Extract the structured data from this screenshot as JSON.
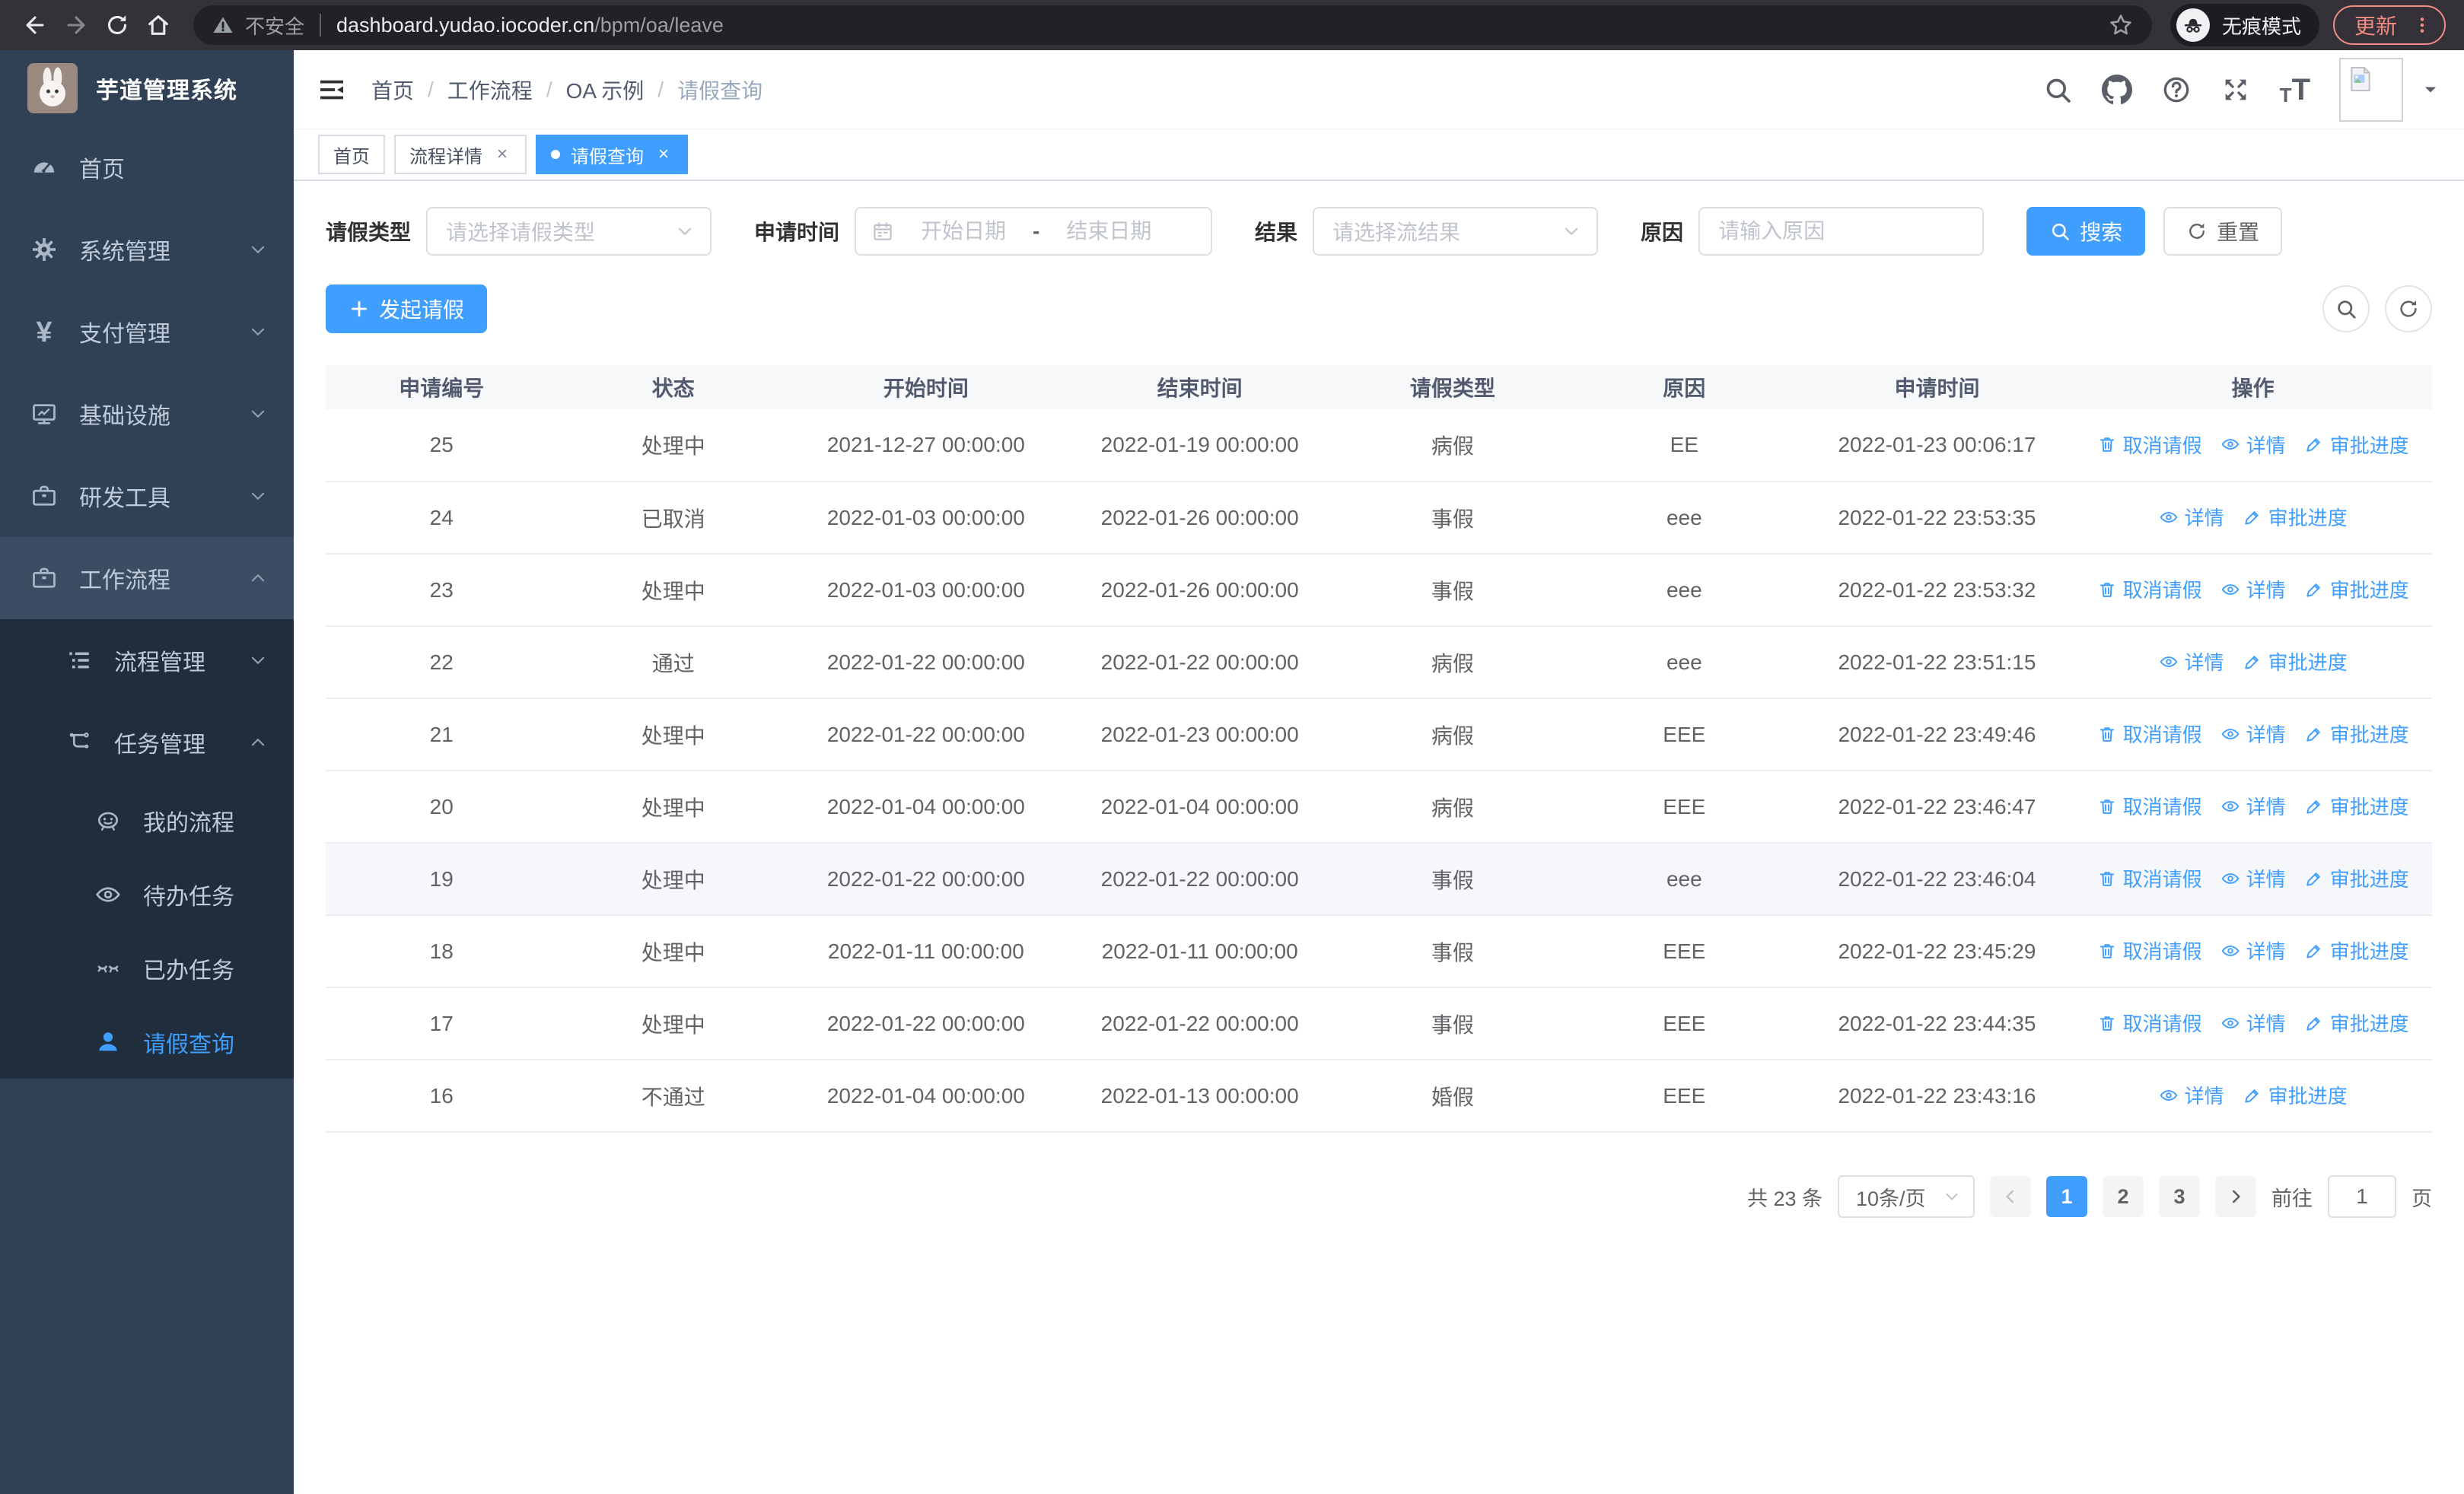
{
  "browser": {
    "security_label": "不安全",
    "url_host": "dashboard.yudao.iocoder.cn",
    "url_path": "/bpm/oa/leave",
    "incognito_label": "无痕模式",
    "update_label": "更新"
  },
  "colors": {
    "primary": "#409eff",
    "sidebar_bg": "#304156",
    "submenu_bg": "#1f2d3d",
    "update_accent": "#f28b82",
    "link_blue": "#409eff"
  },
  "icons": {
    "sidebar": [
      "dashboard-icon",
      "gear-icon",
      "yen-icon",
      "monitor-icon",
      "toolbox-icon",
      "toolbox-icon",
      "list-icon",
      "flow-icon",
      "robot-icon",
      "eye-icon",
      "eye-closed-icon",
      "person-icon"
    ],
    "navbar": [
      "search-icon",
      "github-icon",
      "question-icon",
      "fullscreen-icon",
      "font-size-icon",
      "avatar-placeholder",
      "caret-down-icon"
    ]
  },
  "sidebar": {
    "title": "芋道管理系统",
    "items": [
      {
        "label": "首页"
      },
      {
        "label": "系统管理"
      },
      {
        "label": "支付管理"
      },
      {
        "label": "基础设施"
      },
      {
        "label": "研发工具"
      },
      {
        "label": "工作流程"
      },
      {
        "label": "流程管理"
      },
      {
        "label": "任务管理"
      },
      {
        "label": "我的流程"
      },
      {
        "label": "待办任务"
      },
      {
        "label": "已办任务"
      },
      {
        "label": "请假查询"
      }
    ]
  },
  "breadcrumb": {
    "items": [
      "首页",
      "工作流程",
      "OA 示例",
      "请假查询"
    ]
  },
  "tabs": [
    {
      "label": "首页"
    },
    {
      "label": "流程详情"
    },
    {
      "label": "请假查询"
    }
  ],
  "filters": {
    "leave_type_label": "请假类型",
    "leave_type_placeholder": "请选择请假类型",
    "apply_time_label": "申请时间",
    "start_date_placeholder": "开始日期",
    "range_separator": "-",
    "end_date_placeholder": "结束日期",
    "result_label": "结果",
    "result_placeholder": "请选择流结果",
    "reason_label": "原因",
    "reason_placeholder": "请输入原因",
    "search_label": "搜索",
    "reset_label": "重置"
  },
  "toolbar": {
    "create_label": "发起请假"
  },
  "table": {
    "columns": [
      "申请编号",
      "状态",
      "开始时间",
      "结束时间",
      "请假类型",
      "原因",
      "申请时间",
      "操作"
    ],
    "actions": {
      "cancel": "取消请假",
      "detail": "详情",
      "progress": "审批进度"
    },
    "rows": [
      {
        "id": "25",
        "status": "处理中",
        "start": "2021-12-27 00:00:00",
        "end": "2022-01-19 00:00:00",
        "type": "病假",
        "reason": "EE",
        "apply_time": "2022-01-23 00:06:17"
      },
      {
        "id": "24",
        "status": "已取消",
        "start": "2022-01-03 00:00:00",
        "end": "2022-01-26 00:00:00",
        "type": "事假",
        "reason": "eee",
        "apply_time": "2022-01-22 23:53:35"
      },
      {
        "id": "23",
        "status": "处理中",
        "start": "2022-01-03 00:00:00",
        "end": "2022-01-26 00:00:00",
        "type": "事假",
        "reason": "eee",
        "apply_time": "2022-01-22 23:53:32"
      },
      {
        "id": "22",
        "status": "通过",
        "start": "2022-01-22 00:00:00",
        "end": "2022-01-22 00:00:00",
        "type": "病假",
        "reason": "eee",
        "apply_time": "2022-01-22 23:51:15"
      },
      {
        "id": "21",
        "status": "处理中",
        "start": "2022-01-22 00:00:00",
        "end": "2022-01-23 00:00:00",
        "type": "病假",
        "reason": "EEE",
        "apply_time": "2022-01-22 23:49:46"
      },
      {
        "id": "20",
        "status": "处理中",
        "start": "2022-01-04 00:00:00",
        "end": "2022-01-04 00:00:00",
        "type": "病假",
        "reason": "EEE",
        "apply_time": "2022-01-22 23:46:47"
      },
      {
        "id": "19",
        "status": "处理中",
        "start": "2022-01-22 00:00:00",
        "end": "2022-01-22 00:00:00",
        "type": "事假",
        "reason": "eee",
        "apply_time": "2022-01-22 23:46:04"
      },
      {
        "id": "18",
        "status": "处理中",
        "start": "2022-01-11 00:00:00",
        "end": "2022-01-11 00:00:00",
        "type": "事假",
        "reason": "EEE",
        "apply_time": "2022-01-22 23:45:29"
      },
      {
        "id": "17",
        "status": "处理中",
        "start": "2022-01-22 00:00:00",
        "end": "2022-01-22 00:00:00",
        "type": "事假",
        "reason": "EEE",
        "apply_time": "2022-01-22 23:44:35"
      },
      {
        "id": "16",
        "status": "不通过",
        "start": "2022-01-04 00:00:00",
        "end": "2022-01-13 00:00:00",
        "type": "婚假",
        "reason": "EEE",
        "apply_time": "2022-01-22 23:43:16"
      }
    ]
  },
  "pagination": {
    "total_label": "共 23 条",
    "page_size": "10条/页",
    "pages": [
      "1",
      "2",
      "3"
    ],
    "active_page": "1",
    "goto_label": "前往",
    "goto_value": "1",
    "goto_suffix": "页"
  }
}
